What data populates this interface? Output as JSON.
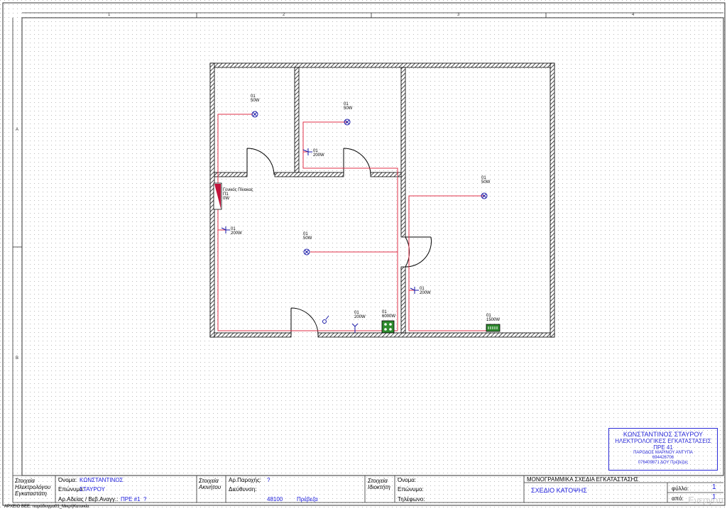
{
  "grid": {
    "columns": [
      "1",
      "2",
      "3",
      "4"
    ],
    "rows": [
      "A",
      "B"
    ]
  },
  "plan": {
    "fixtures": [
      {
        "id": "lamp-1",
        "circuit": "01",
        "power": "50W"
      },
      {
        "id": "lamp-2",
        "circuit": "01",
        "power": "50W"
      },
      {
        "id": "lamp-3",
        "circuit": "01",
        "power": "50W"
      },
      {
        "id": "lamp-4",
        "circuit": "01",
        "power": "50W"
      },
      {
        "id": "switch-1",
        "circuit": "01",
        "power": "200W"
      },
      {
        "id": "switch-2",
        "circuit": "01",
        "power": "200W"
      },
      {
        "id": "switch-3",
        "circuit": "01",
        "power": "200W"
      },
      {
        "id": "outlet-1",
        "circuit": "01",
        "power": "200W"
      },
      {
        "id": "cooker",
        "circuit": "01",
        "power": "6000W"
      },
      {
        "id": "heater",
        "circuit": "01",
        "power": "1500W"
      }
    ],
    "panel": {
      "title": "Γενικός Πίνακας",
      "name": "Π1",
      "power": "0W"
    }
  },
  "stamp": {
    "line1": "ΚΩΝΣΤΑΝΤΙΝΟΣ ΣΤΑΥΡΟΥ",
    "line2": "ΗΛΕΚΤΡΟΛΟΓΙΚΕΣ ΕΓΚΑΤΑΣΤΑΣΕΙΣ",
    "line3": "ΠΡΕ 41",
    "line4": "ΠΑΡΟΔΟΣ ΜΑΡΙΝΟΥ ΑΝΤΥΠΑ",
    "line5": "694426706",
    "line6": "076409871 ΔΟΥ Πρέβεζας"
  },
  "titleblock": {
    "installer_heading": "Στοιχεία Ηλεκτρολόγου Εγκαταστάτη",
    "name_label": "Όνομα:",
    "name_value": "ΚΩΝΣΤΑΝΤΙΝΟΣ",
    "surname_label": "Επώνυμο:",
    "surname_value": "ΣΤΑΥΡΟΥ",
    "license_label": "Αρ.Αδείας / Βεβ.Αναγγ.:",
    "license_value": "ΠΡΕ #1",
    "license_extra": "?",
    "property_heading": "Στοιχεία Ακινήτου",
    "supply_label": "Αρ.Παροχής:",
    "supply_value": "?",
    "address_label": "Διεύθυνση:",
    "zip_value": "48100",
    "city_value": "Πρέβεζα",
    "owner_heading": "Στοιχεία Ιδιοκτήτη",
    "owner_name_label": "Όνομα:",
    "owner_surname_label": "Επώνυμο:",
    "phone_label": "Τηλέφωνο:",
    "drawing_type": "ΜΟΝΟΓΡΑΜΜΙΚΑ ΣΧΕΔΙΑ ΕΓΚΑΤΑΣΤΑΣΗΣ",
    "drawing_title": "ΣΧΕΔΙΟ ΚΑΤΟΨΗΣ",
    "sheet_label": "φύλλο:",
    "sheet_value": "1",
    "of_label": "από:",
    "of_value": "1"
  },
  "footer": {
    "file_label": "ΑΡΧΕΙΟ ΒΕΕ:",
    "file_value": "παράδειγμα01_ΜικρήΚατοικία"
  },
  "watermark": "Ενεργοπ",
  "colors": {
    "wire": "#e0304a",
    "stamp": "#2a2ad8",
    "panel": "#c0143c",
    "fixture": "#1a1aa8"
  }
}
